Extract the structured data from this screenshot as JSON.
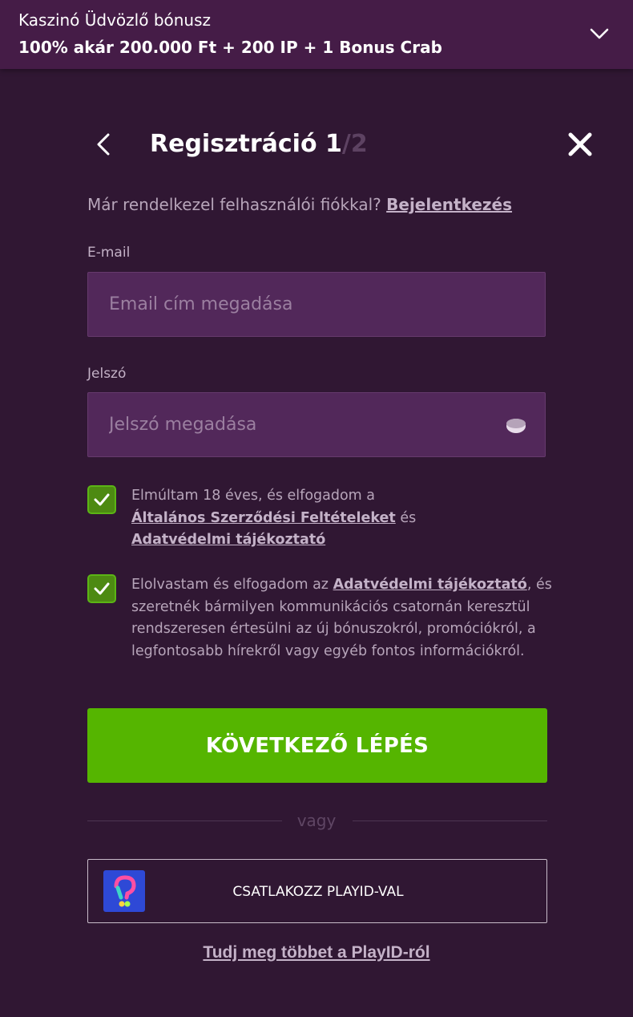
{
  "banner": {
    "title": "Kaszinó Üdvözlő bónusz",
    "offer": "100% akár 200.000 Ft + 200 IP + 1 Bonus Crab",
    "toggle_icon": "chevron-down-icon"
  },
  "header": {
    "title_main": "Regisztráció 1",
    "title_total": "/2",
    "back_icon": "chevron-left-icon",
    "close_icon": "close-icon"
  },
  "login_prompt": {
    "text": "Már rendelkezel felhasználói fiókkal?",
    "link": "Bejelentkezés"
  },
  "email": {
    "label": "E-mail",
    "placeholder": "Email cím megadása",
    "value": ""
  },
  "password": {
    "label": "Jelszó",
    "placeholder": "Jelszó megadása",
    "value": "",
    "toggle_icon": "eye-icon"
  },
  "consents": [
    {
      "checked": true,
      "text_before": "Elmúltam 18 éves, és elfogadom a",
      "link1": "Általános Szerződési Feltételeket",
      "middle": "és",
      "link2": "Adatvédelmi tájékoztató"
    },
    {
      "checked": true,
      "text_before": "Elolvastam és elfogadom az",
      "link1": "Adatvédelmi tájékoztató",
      "text_after": ", és szeretnék bármilyen kommunikációs csatornán keresztül rendszeresen értesülni az új bónuszokról, promóciókról, a legfontosabb hírekről vagy egyéb fontos információkról."
    }
  ],
  "next_button": "KÖVETKEZŐ LÉPÉS",
  "divider_text": "vagy",
  "playid_button": "CSATLAKOZZ PLAYID-VAL",
  "playid_learn_more": "Tudj meg többet a PlayID-ról",
  "colors": {
    "background": "#301733",
    "banner": "#451c47",
    "input_bg": "#52285a",
    "accent_green": "#55b500",
    "checkbox_green": "#4d8a12"
  }
}
